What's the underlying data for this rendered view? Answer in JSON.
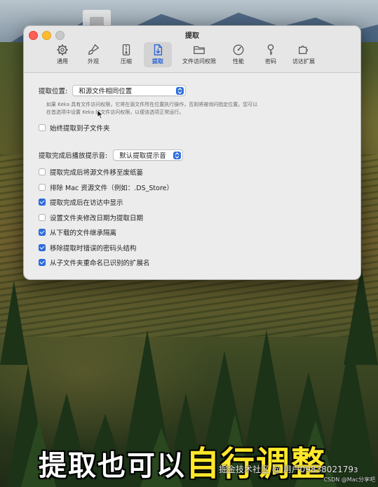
{
  "window": {
    "title": "提取",
    "tabs": [
      {
        "label": "通用",
        "icon": "gear-icon"
      },
      {
        "label": "外观",
        "icon": "brush-icon"
      },
      {
        "label": "压缩",
        "icon": "archive-icon"
      },
      {
        "label": "提取",
        "icon": "extract-doc-icon",
        "selected": true
      },
      {
        "label": "文件访问权限",
        "icon": "folder-icon"
      },
      {
        "label": "性能",
        "icon": "gauge-icon"
      },
      {
        "label": "密码",
        "icon": "key-icon"
      },
      {
        "label": "访达扩展",
        "icon": "puzzle-icon"
      }
    ]
  },
  "extract": {
    "location_label": "提取位置:",
    "location_value": "和源文件相同位置",
    "help_line1": "如果 Keka 具有文件访问权限，它将在源文件所在位置执行操作，否则将被询问指定位置。您可以",
    "help_line2": "在首选项中设置 Keka 的文件访问权限，以便该选项正常运行。",
    "always_subfolder": {
      "label": "始终提取到子文件夹",
      "checked": false
    },
    "sound_label": "提取完成后播放提示音:",
    "sound_value": "默认提取提示音",
    "options": [
      {
        "label": "提取完成后将源文件移至废纸篓",
        "checked": false
      },
      {
        "label": "排除 Mac 资源文件（例如：.DS_Store）",
        "checked": false
      },
      {
        "label": "提取完成后在访达中显示",
        "checked": true
      },
      {
        "label": "设置文件夹修改日期为提取日期",
        "checked": false
      },
      {
        "label": "从下载的文件继承隔离",
        "checked": true
      },
      {
        "label": "移除提取时错误的密码头结构",
        "checked": true
      },
      {
        "label": "从子文件夹重命名已识别的扩展名",
        "checked": true
      }
    ]
  },
  "overlay": {
    "caption_white": "提取也可以",
    "caption_yellow": "自行调整",
    "watermark_main": "掘金技术社区 @ 用户0983802179з",
    "watermark_small": "CSDN @Mac分享吧"
  },
  "colors": {
    "accent": "#2f6fe0",
    "caption_yellow": "#ffe82a"
  }
}
